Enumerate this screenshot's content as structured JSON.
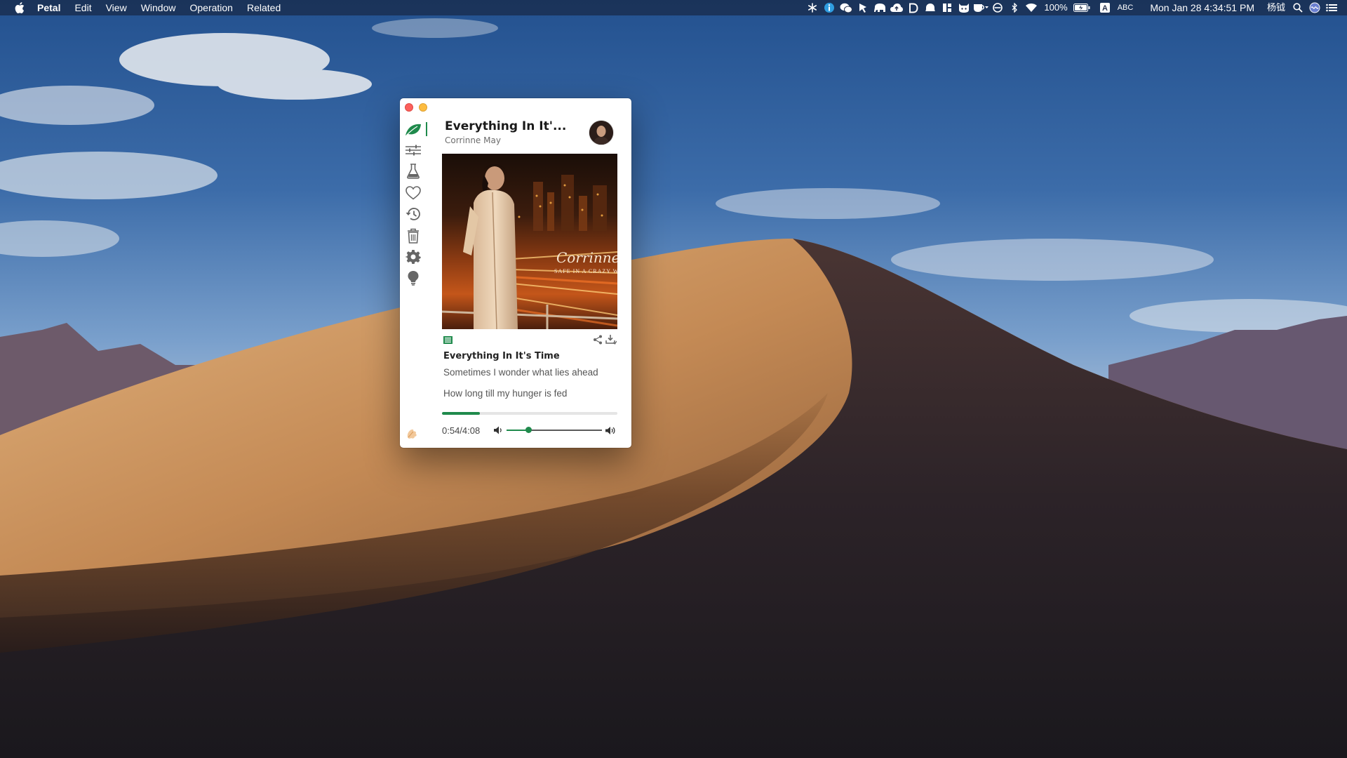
{
  "menubar": {
    "app_name": "Petal",
    "menus": [
      "Edit",
      "View",
      "Window",
      "Operation",
      "Related"
    ],
    "battery": "100%",
    "input_method": "ABC",
    "clock": "Mon Jan 28  4:34:51 PM",
    "user_name": "杨钺",
    "tray_icons": [
      "snowflake-icon",
      "info-icon",
      "wechat-icon",
      "cursor-icon",
      "elephant-icon",
      "cloud-upload-icon",
      "d-icon",
      "bell-icon",
      "layout-icon",
      "cat-icon",
      "cup-icon",
      "circle-icon",
      "bluetooth-icon",
      "wifi-icon",
      "battery-icon",
      "spotlight-icon",
      "siri-icon",
      "notification-icon"
    ]
  },
  "player": {
    "song_title": "Everything In It'...",
    "artist": "Corrinne May",
    "cover_text": "Corrinne May",
    "cover_subtext": "SAFE IN A CRAZY WORLD",
    "lyrics": {
      "title": "Everything In It's Time",
      "line1": "Sometimes I wonder what lies ahead",
      "line2": "How long till my hunger is fed"
    },
    "time": "0:54/4:08",
    "progress_fraction": 0.2177,
    "volume_fraction": 0.23,
    "accent_color": "#1f8a4c"
  },
  "sidebar": {
    "items": [
      "leaf-icon",
      "sliders-icon",
      "flask-icon",
      "heart-icon",
      "history-icon",
      "trash-icon",
      "gear-icon",
      "lightbulb-icon"
    ],
    "active": "leaf-icon"
  }
}
